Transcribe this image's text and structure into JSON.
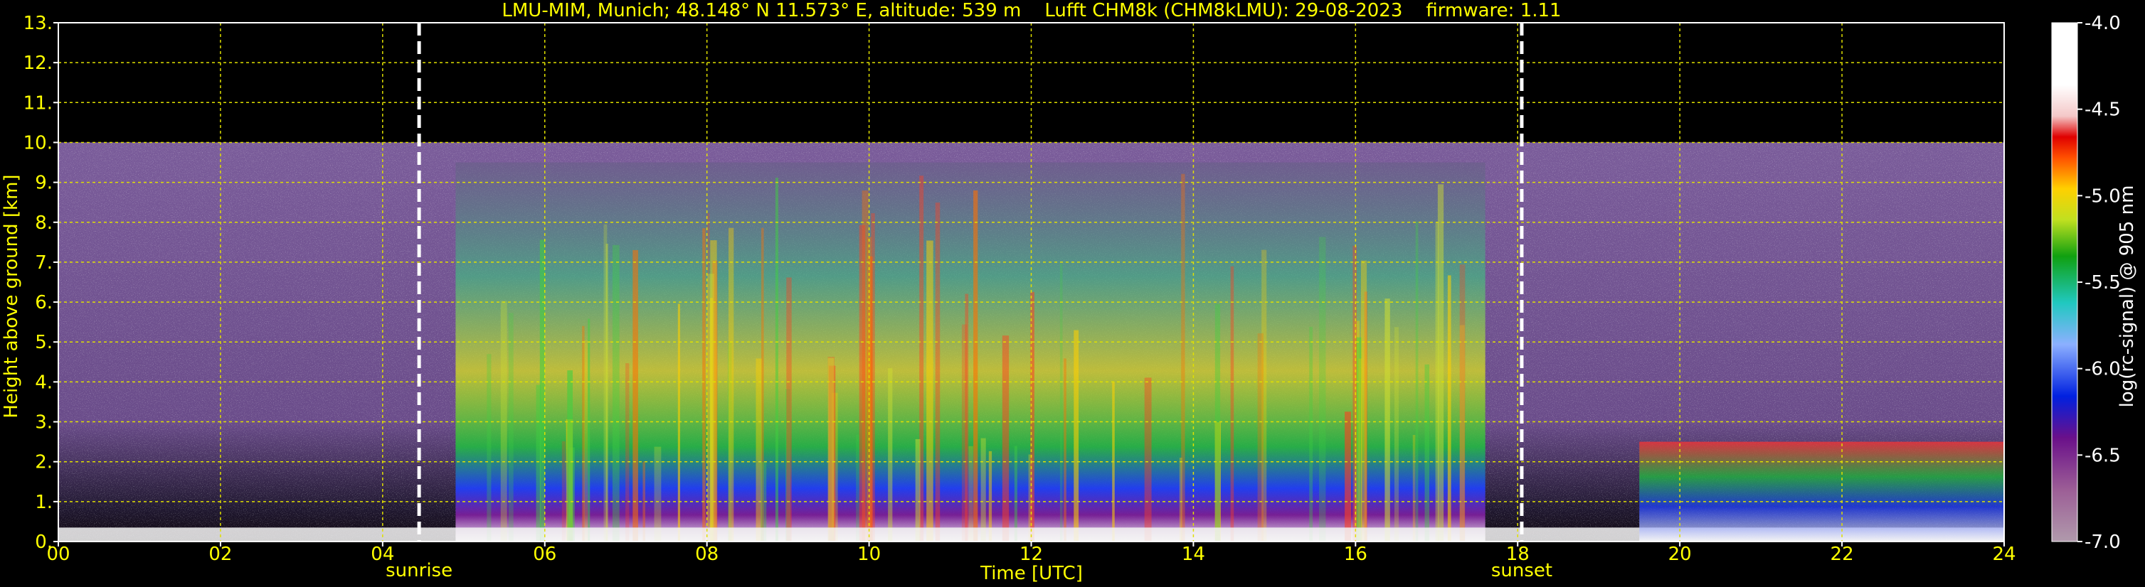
{
  "chart_data": {
    "type": "heatmap",
    "title": "LMU-MIM, Munich; 48.148° N 11.573° E, altitude: 539 m    Lufft CHM8k (CHM8kLMU): 29-08-2023    firmware: 1.11",
    "xlabel": "Time [UTC]",
    "ylabel": "Height above ground [km]",
    "xlim": [
      0,
      24
    ],
    "ylim": [
      0,
      13
    ],
    "xticks": [
      "00",
      "02",
      "04",
      "06",
      "08",
      "10",
      "12",
      "14",
      "16",
      "18",
      "20",
      "22",
      "24"
    ],
    "yticks": [
      "0.",
      "1.",
      "2.",
      "3.",
      "4.",
      "5.",
      "6.",
      "7.",
      "8.",
      "9.",
      "10.",
      "11.",
      "12.",
      "13."
    ],
    "grid": true,
    "data_max_height_km": 10,
    "events": [
      {
        "label": "sunrise",
        "time": 4.45
      },
      {
        "label": "sunset",
        "time": 18.05
      }
    ],
    "colorbar": {
      "label": "log(rc-signal) @ 905 nm",
      "ticks": [
        "-4.0",
        "-4.5",
        "-5.0",
        "-5.5",
        "-6.0",
        "-6.5",
        "-7.0"
      ],
      "range": [
        -7.0,
        -4.0
      ]
    },
    "colors": {
      "text": "#ffff00",
      "grid": "#e0e000",
      "background": "#000000",
      "event_line": "#ffffff"
    }
  }
}
